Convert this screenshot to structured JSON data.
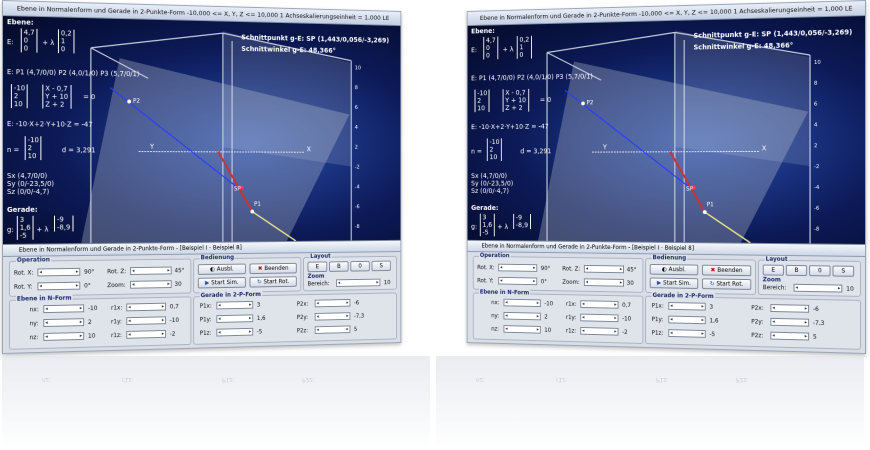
{
  "window_title": "Ebene in Normalenform und Gerade in 2-Punkte-Form   -10,000 <= X, Y, Z <= 10,000   1 Achseskalierungseinheit = 1,000 LE",
  "scene": {
    "heading": "Ebene:",
    "plane_vector_label": "E:",
    "plane_vector_a": [
      "4,7",
      "0",
      "0"
    ],
    "plane_lambda": "+ λ",
    "plane_vector_b": [
      "0,2",
      "1",
      "0"
    ],
    "points_line": "E: P1 (4,7/0/0)    P2 (4,0/1/0)    P3 (5,7/0/1)",
    "normal_form_matrix": [
      "-10",
      "2",
      "10"
    ],
    "normal_form_vars": [
      "X - 0,7",
      "Y + 10",
      "Z + 2"
    ],
    "normal_form_eq": "= 0",
    "coordinate_form": "E:  -10·X+2·Y+10·Z = -47",
    "normal_vector_label": "n =",
    "normal_vector": [
      "-10",
      "2",
      "10"
    ],
    "distance": "d = 3,291",
    "sx": "Sx (4,7/0/0)",
    "sy": "Sy (0/-23,5/0)",
    "sz": "Sz (0/0/-4,7)",
    "line_heading": "Gerade:",
    "line_prefix": "g:",
    "line_vector_a": [
      "3",
      "1,6",
      "-5"
    ],
    "line_lambda": "+ λ",
    "line_vector_b": [
      "-9",
      "-8,9",
      ""
    ],
    "intersection": "Schnittpunkt g-E: SP (1,443/0,056/-3,269)",
    "angle": "Schnittwinkel g-E: 48,366°",
    "axis_x": "X",
    "axis_y": "Y",
    "axis_z_ticks": [
      "10",
      "8",
      "6",
      "4",
      "2",
      "-2",
      "-4",
      "-6",
      "-8",
      "-10"
    ],
    "label_p1": "P1",
    "label_p2": "P2",
    "label_sp": "SP"
  },
  "panel": {
    "title": "Ebene in Normalenform und Gerade in 2-Punkte-Form - [Beispiel I - Beispiel 8]",
    "operation": {
      "label": "Operation",
      "rot_x_label": "Rot. X:",
      "rot_x_value": "90°",
      "rot_y_label": "Rot. Y:",
      "rot_y_value": "0°",
      "rot_z_label": "Rot. Z:",
      "rot_z_value": "45°",
      "zoom_label": "Zoom:",
      "zoom_value": "30"
    },
    "bedienung": {
      "label": "Bedienung",
      "ausbl": "Ausbl.",
      "beenden": "Beenden",
      "start_sim": "Start Sim.",
      "start_rot": "Start Rot."
    },
    "layout": {
      "label": "Layout",
      "b1": "E",
      "b2": "B",
      "b3": "0",
      "b4": "S",
      "zoom_label": "Zoom",
      "bereich_label": "Bereich:",
      "bereich_value": "10"
    },
    "ebene": {
      "label": "Ebene in N-Form",
      "rows": [
        {
          "l1": "nx:",
          "v1": "-10",
          "l2": "r1x:",
          "v2": "0,7"
        },
        {
          "l1": "ny:",
          "v1": "2",
          "l2": "r1y:",
          "v2": "-10"
        },
        {
          "l1": "nz:",
          "v1": "10",
          "l2": "r1z:",
          "v2": "-2"
        }
      ]
    },
    "gerade": {
      "label": "Gerade in 2-P-Form",
      "rows": [
        {
          "l1": "P1x:",
          "v1": "3",
          "l2": "P2x:",
          "v2": "-6"
        },
        {
          "l1": "P1y:",
          "v1": "1,6",
          "l2": "P2y:",
          "v2": "-7,3"
        },
        {
          "l1": "P1z:",
          "v1": "-5",
          "l2": "P2z:",
          "v2": "5"
        }
      ]
    }
  },
  "colors": {
    "scene_bg": "#0c1a58",
    "plane": "#b4bccc",
    "line": "#d03030",
    "normal": "#2a3cff"
  }
}
